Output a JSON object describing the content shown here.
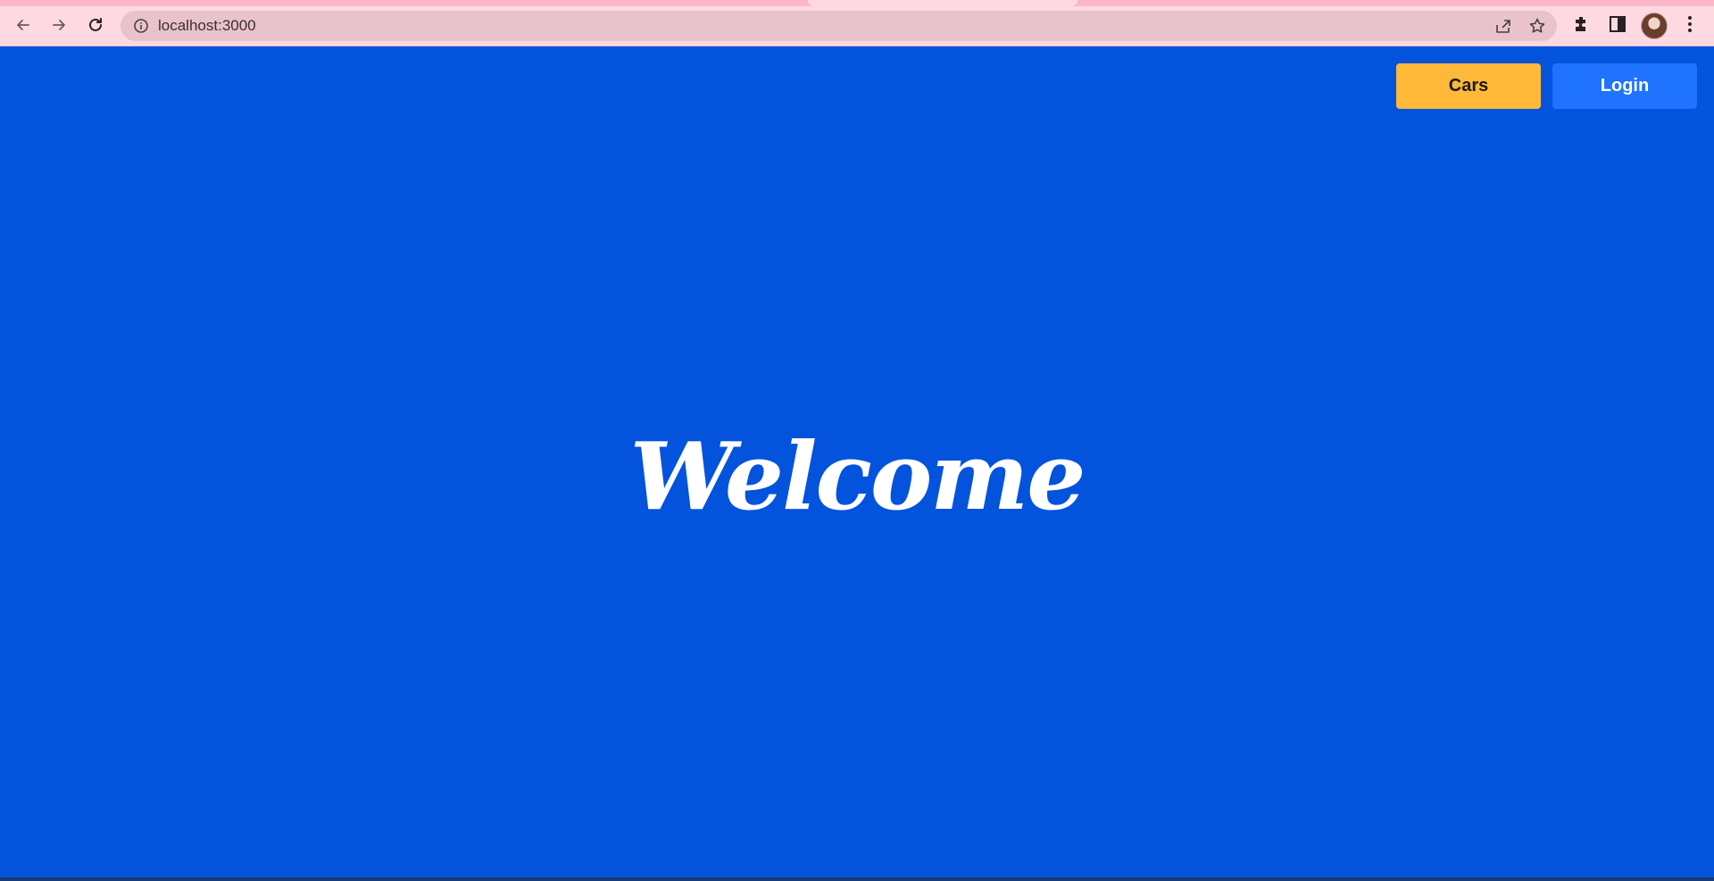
{
  "browser": {
    "url": "localhost:3000"
  },
  "page": {
    "nav": {
      "cars_label": "Cars",
      "login_label": "Login"
    },
    "heading": "Welcome"
  },
  "colors": {
    "page_background": "#0353dd",
    "cars_button": "#ffb837",
    "login_button": "#1f73ff",
    "browser_chrome": "#ffd9e1"
  },
  "icons": [
    "back-icon",
    "forward-icon",
    "reload-icon",
    "info-icon",
    "share-icon",
    "star-icon",
    "extensions-icon",
    "side-panel-icon",
    "avatar",
    "menu-icon"
  ]
}
